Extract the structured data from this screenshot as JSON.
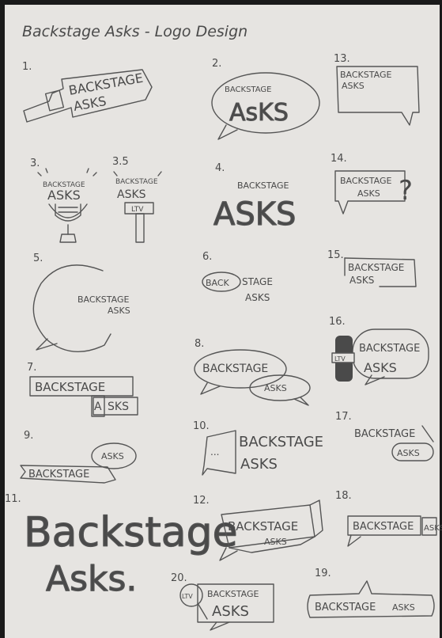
{
  "title": "Backstage Asks - Logo Design",
  "numbers": [
    "1.",
    "2.",
    "13.",
    "3.",
    "3.5",
    "4.",
    "14.",
    "5.",
    "6.",
    "15.",
    "16.",
    "7.",
    "8.",
    "9.",
    "10.",
    "17.",
    "11.",
    "12.",
    "18.",
    "20.",
    "19."
  ],
  "sketches": {
    "s1": [
      "BACKSTAGE",
      "ASKS"
    ],
    "s2": [
      "BACKSTAGE",
      "AsKS"
    ],
    "s13": [
      "BACKSTAGE",
      "ASKS"
    ],
    "s3": [
      "BACKSTAGE",
      "ASKS"
    ],
    "s35": [
      "BACKSTAGE",
      "ASKS",
      "LTV"
    ],
    "s4": [
      "BACKSTAGE",
      "ASKS"
    ],
    "s14": [
      "BACKSTAGE",
      "ASKS",
      "?"
    ],
    "s5": [
      "BACKSTAGE",
      "ASKS"
    ],
    "s6": [
      "BACK",
      "STAGE",
      "ASKS"
    ],
    "s15": [
      "BACKSTAGE",
      "ASKS"
    ],
    "s16": [
      "BACKSTAGE",
      "ASKS",
      "LTV"
    ],
    "s7": [
      "BACKSTAGE",
      "A",
      "SKS"
    ],
    "s8": [
      "BACKSTAGE",
      "ASKS"
    ],
    "s9": [
      "ASKS",
      "BACKSTAGE"
    ],
    "s10": [
      "BACKSTAGE",
      "ASKS",
      "..."
    ],
    "s17": [
      "BACKSTAGE",
      "ASKS"
    ],
    "s11": [
      "Backstage",
      "Asks."
    ],
    "s12": [
      "BACKSTAGE",
      "ASKS"
    ],
    "s18": [
      "BACKSTAGE",
      "ASKS"
    ],
    "s20": [
      "BACKSTAGE",
      "ASKS",
      "LTV"
    ],
    "s19": [
      "BACKSTAGE",
      "ASKS"
    ]
  },
  "colors": {
    "paper": "#e6e4e1",
    "ink": "#4a4a4a",
    "background": "#1a1a1a"
  }
}
